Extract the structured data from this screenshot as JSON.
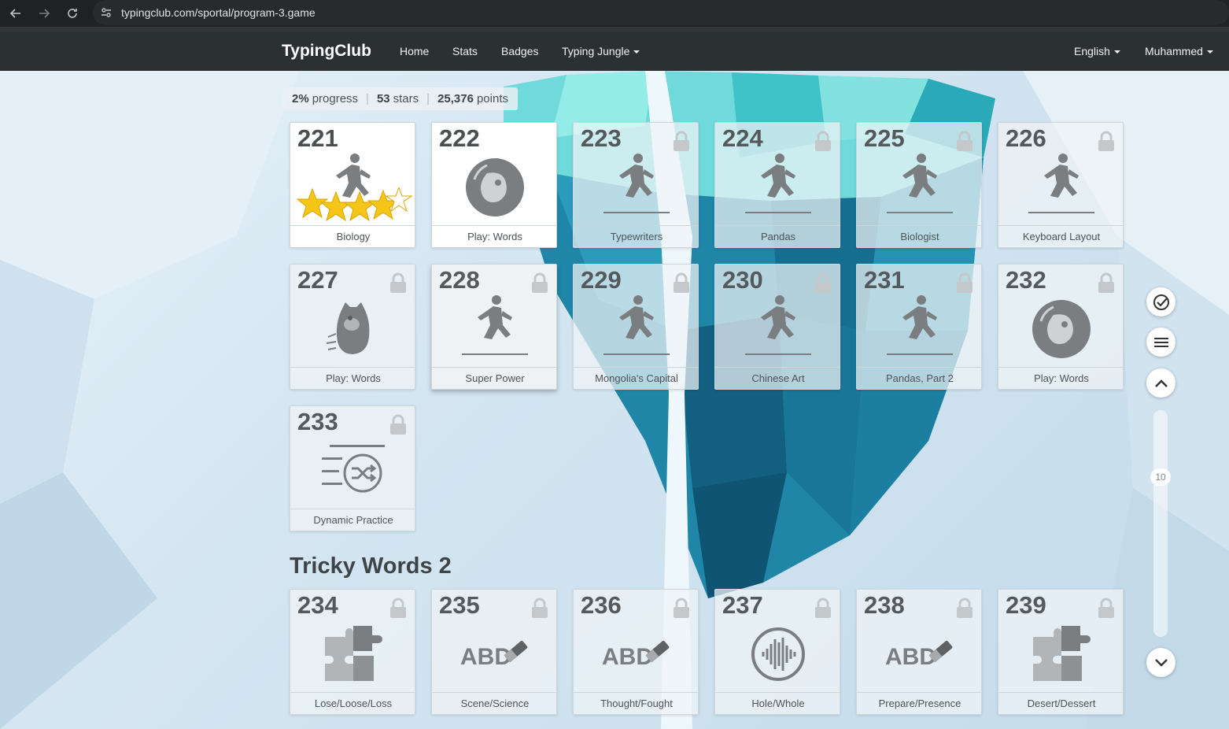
{
  "browser": {
    "url": "typingclub.com/sportal/program-3.game"
  },
  "navbar": {
    "brand": "TypingClub",
    "links": [
      "Home",
      "Stats",
      "Badges"
    ],
    "dropdown_jungle": "Typing Jungle",
    "language": "English",
    "user": "Muhammed"
  },
  "progress": {
    "progress_value": "2%",
    "progress_label": "progress",
    "stars_value": "53",
    "stars_label": "stars",
    "points_value": "25,376",
    "points_label": "points"
  },
  "lessons": [
    {
      "num": "221",
      "label": "Biology",
      "icon": "runner-icon",
      "locked": false,
      "stars": 4
    },
    {
      "num": "222",
      "label": "Play: Words",
      "icon": "game-bubble-icon",
      "locked": false
    },
    {
      "num": "223",
      "label": "Typewriters",
      "icon": "runner-icon",
      "locked": true
    },
    {
      "num": "224",
      "label": "Pandas",
      "icon": "runner-icon",
      "locked": true
    },
    {
      "num": "225",
      "label": "Biologist",
      "icon": "runner-icon",
      "locked": true
    },
    {
      "num": "226",
      "label": "Keyboard Layout",
      "icon": "runner-icon",
      "locked": true
    },
    {
      "num": "227",
      "label": "Play: Words",
      "icon": "monster-icon",
      "locked": true
    },
    {
      "num": "228",
      "label": "Super Power",
      "icon": "runner-icon",
      "locked": true
    },
    {
      "num": "229",
      "label": "Mongolia's Capital",
      "icon": "runner-icon",
      "locked": true
    },
    {
      "num": "230",
      "label": "Chinese Art",
      "icon": "runner-icon",
      "locked": true
    },
    {
      "num": "231",
      "label": "Pandas, Part 2",
      "icon": "runner-icon",
      "locked": true
    },
    {
      "num": "232",
      "label": "Play: Words",
      "icon": "game-bubble-icon",
      "locked": true
    },
    {
      "num": "233",
      "label": "Dynamic Practice",
      "icon": "shuffle-list-icon",
      "locked": true
    }
  ],
  "section2": {
    "title": "Tricky Words 2",
    "lessons": [
      {
        "num": "234",
        "label": "Lose/Loose/Loss",
        "icon": "puzzle-icon",
        "locked": true
      },
      {
        "num": "235",
        "label": "Scene/Science",
        "icon": "abc-eraser-icon",
        "locked": true
      },
      {
        "num": "236",
        "label": "Thought/Fought",
        "icon": "abc-eraser-icon",
        "locked": true
      },
      {
        "num": "237",
        "label": "Hole/Whole",
        "icon": "audio-wave-icon",
        "locked": true
      },
      {
        "num": "238",
        "label": "Prepare/Presence",
        "icon": "abc-eraser-icon",
        "locked": true
      },
      {
        "num": "239",
        "label": "Desert/Dessert",
        "icon": "puzzle-icon",
        "locked": true
      }
    ]
  },
  "abc_text": "ABD",
  "sidebar": {
    "scroll_value": "10"
  },
  "colors": {
    "navbar": "#2b3033",
    "icon_gray": "#7b7e80",
    "star_gold": "#f5c518",
    "iceberg_teal": "#1d7fa0"
  }
}
